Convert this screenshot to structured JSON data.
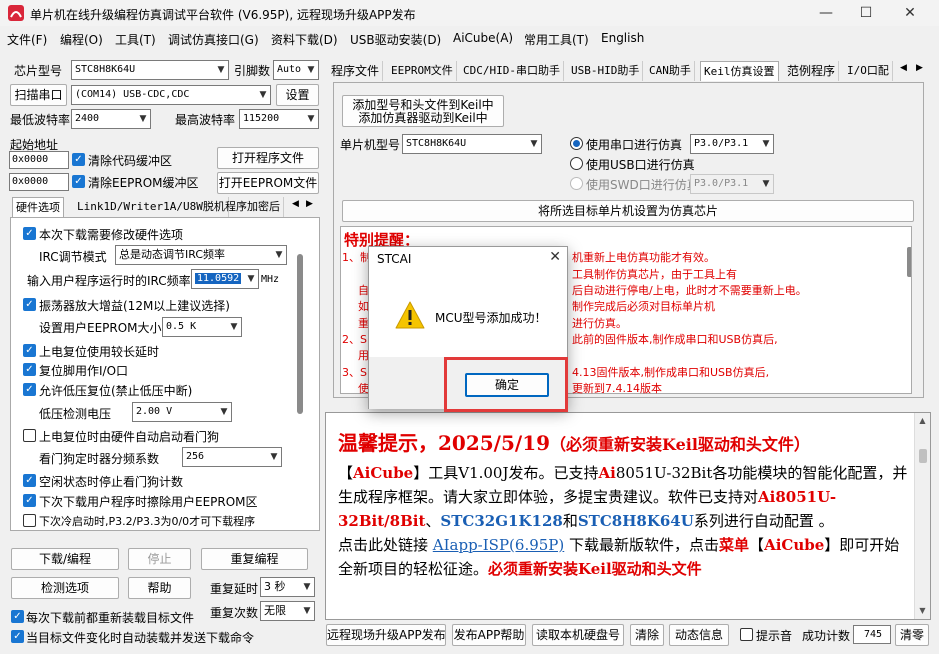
{
  "window": {
    "title": "单片机在线升级编程仿真调试平台软件 (V6.95P), 远程现场升级APP发布",
    "min": "—",
    "max": "☐",
    "close": "✕"
  },
  "menu": [
    "文件(F)",
    "编程(O)",
    "工具(T)",
    "调试仿真接口(G)",
    "资料下载(D)",
    "USB驱动安装(D)",
    "AiCube(A)",
    "常用工具(T)",
    "English"
  ],
  "left": {
    "chip_type_label": "芯片型号",
    "chip_type_value": "STC8H8K64U",
    "pin_count_label": "引脚数",
    "pin_count_value": "Auto",
    "scan_port_label": "扫描串口",
    "port_value": "(COM14) USB-CDC,CDC",
    "settings_button": "设置",
    "min_baud_label": "最低波特率",
    "min_baud_value": "2400",
    "max_baud_label": "最高波特率",
    "max_baud_value": "115200",
    "start_addr_label": "起始地址",
    "addr1": "0x0000",
    "clear_code_buffer": "清除代码缓冲区",
    "open_program_file": "打开程序文件",
    "addr2": "0x0000",
    "clear_eeprom_buffer": "清除EEPROM缓冲区",
    "open_eeprom_file": "打开EEPROM文件",
    "tabs": [
      "硬件选项",
      "Link1D/Writer1A/U8W脱机",
      "程序加密后"
    ],
    "hw": {
      "opt_modify_hw": "本次下载需要修改硬件选项",
      "irc_mode_label": "IRC调节模式",
      "irc_mode_value": "总是动态调节IRC频率",
      "irc_freq_label": "输入用户程序运行时的IRC频率",
      "irc_freq_value": "11.0592",
      "irc_freq_unit": "MHz",
      "opt_amp_gain": "振荡器放大增益(12M以上建议选择)",
      "eeprom_size_label": "设置用户EEPROM大小",
      "eeprom_size_value": "0.5 K",
      "opt_long_reset": "上电复位使用较长延时",
      "opt_reset_io": "复位脚用作I/O口",
      "opt_lvd_reset": "允许低压复位(禁止低压中断)",
      "lvd_voltage_label": "低压检测电压",
      "lvd_voltage_value": "2.00 V",
      "opt_wdt_auto": "上电复位时由硬件自动启动看门狗",
      "wdt_prescale_label": "看门狗定时器分频系数",
      "wdt_prescale_value": "256",
      "opt_idle_wdt": "空闲状态时停止看门狗计数",
      "opt_erase_eeprom": "下次下载用户程序时擦除用户EEPROM区",
      "opt_cold_boot": "下次冷启动时,P3.2/P3.3为0/0才可下载程序"
    },
    "download_button": "下载/编程",
    "stop_button": "停止",
    "reprogram_button": "重复编程",
    "detect_button": "检测选项",
    "help_button": "帮助",
    "repeat_delay_label": "重复延时",
    "repeat_delay_value": "3 秒",
    "repeat_count_label": "重复次数",
    "repeat_count_value": "无限",
    "opt_reload_each": "每次下载前都重新装载目标文件",
    "opt_auto_send": "当目标文件变化时自动装载并发送下载命令"
  },
  "right": {
    "tabs": [
      "程序文件",
      "EEPROM文件",
      "CDC/HID-串口助手",
      "USB-HID助手",
      "CAN助手",
      "Keil仿真设置",
      "范例程序",
      "I/O口配"
    ],
    "add_keil_button_line1": "添加型号和头文件到Keil中",
    "add_keil_button_line2": "添加仿真器驱动到Keil中",
    "mcu_label": "单片机型号",
    "mcu_value": "STC8H8K64U",
    "radio_serial": "使用串口进行仿真",
    "serial_port_value": "P3.0/P3.1",
    "radio_usb": "使用USB口进行仿真",
    "radio_swd": "使用SWD口进行仿真",
    "swd_port_value": "P3.0/P3.1",
    "set_emulator_button": "将所选目标单片机设置为仿真芯片",
    "notice_title": "特别提醒：",
    "notice_lines": [
      "1、制",
      "机重新上电仿真功能才有效。",
      "工具制作仿真芯片，由于工具上有",
      "自",
      "后自动进行停电/上电，此时才不需要重新上电。",
      "如",
      "制作完成后必须对目标单片机",
      "重",
      "进行仿真。",
      "2、S",
      "此前的固件版本,制作成串口和USB仿真后,",
      "用",
      "3、S",
      "4.13固件版本,制作成串口和USB仿真后,",
      "使",
      "更新到7.4.14版本"
    ],
    "rich": {
      "headline": "温馨提示，2025/5/19",
      "headline_note": "（必须重新安装Keil驱动和头文件）",
      "p1_a": "【",
      "p1_aicube": "AiCube",
      "p1_b": "】工具V1.00J发布。已支持",
      "p1_ai": "Ai",
      "p1_c": "8051U-32Bit各功能模块的智能化配置，并生成程序框架。请大家立即体验，多提宝贵建议。软件已支持对",
      "p1_d": "Ai8051U-32Bit/8Bit",
      "p1_e": "、",
      "p1_f": "STC32G1K128",
      "p1_g": "和",
      "p1_h": "STC8H8K64U",
      "p1_i": "系列进行自动配置 。",
      "p2_a": "点击此处链接 ",
      "p2_link": "AIapp-ISP(6.95P)",
      "p2_b": " 下载最新版软件，点击",
      "p2_menu": "菜单",
      "p2_c": "【",
      "p2_aicube": "AiCube",
      "p2_d": "】即可开始全新项目的轻松征途。",
      "p2_e": "必须重新安装Keil驱动和头文件"
    },
    "bottom": {
      "remote_upgrade": "远程现场升级APP发布",
      "publish_help": "发布APP帮助",
      "read_disk": "读取本机硬盘号",
      "clear": "清除",
      "dynamic_info": "动态信息",
      "prompt_sound": "提示音",
      "success_count_label": "成功计数",
      "success_count_value": "745",
      "reset_count": "清零"
    }
  },
  "dialog": {
    "title": "STCAI",
    "message": "MCU型号添加成功！",
    "ok": "确定",
    "close": "✕"
  }
}
